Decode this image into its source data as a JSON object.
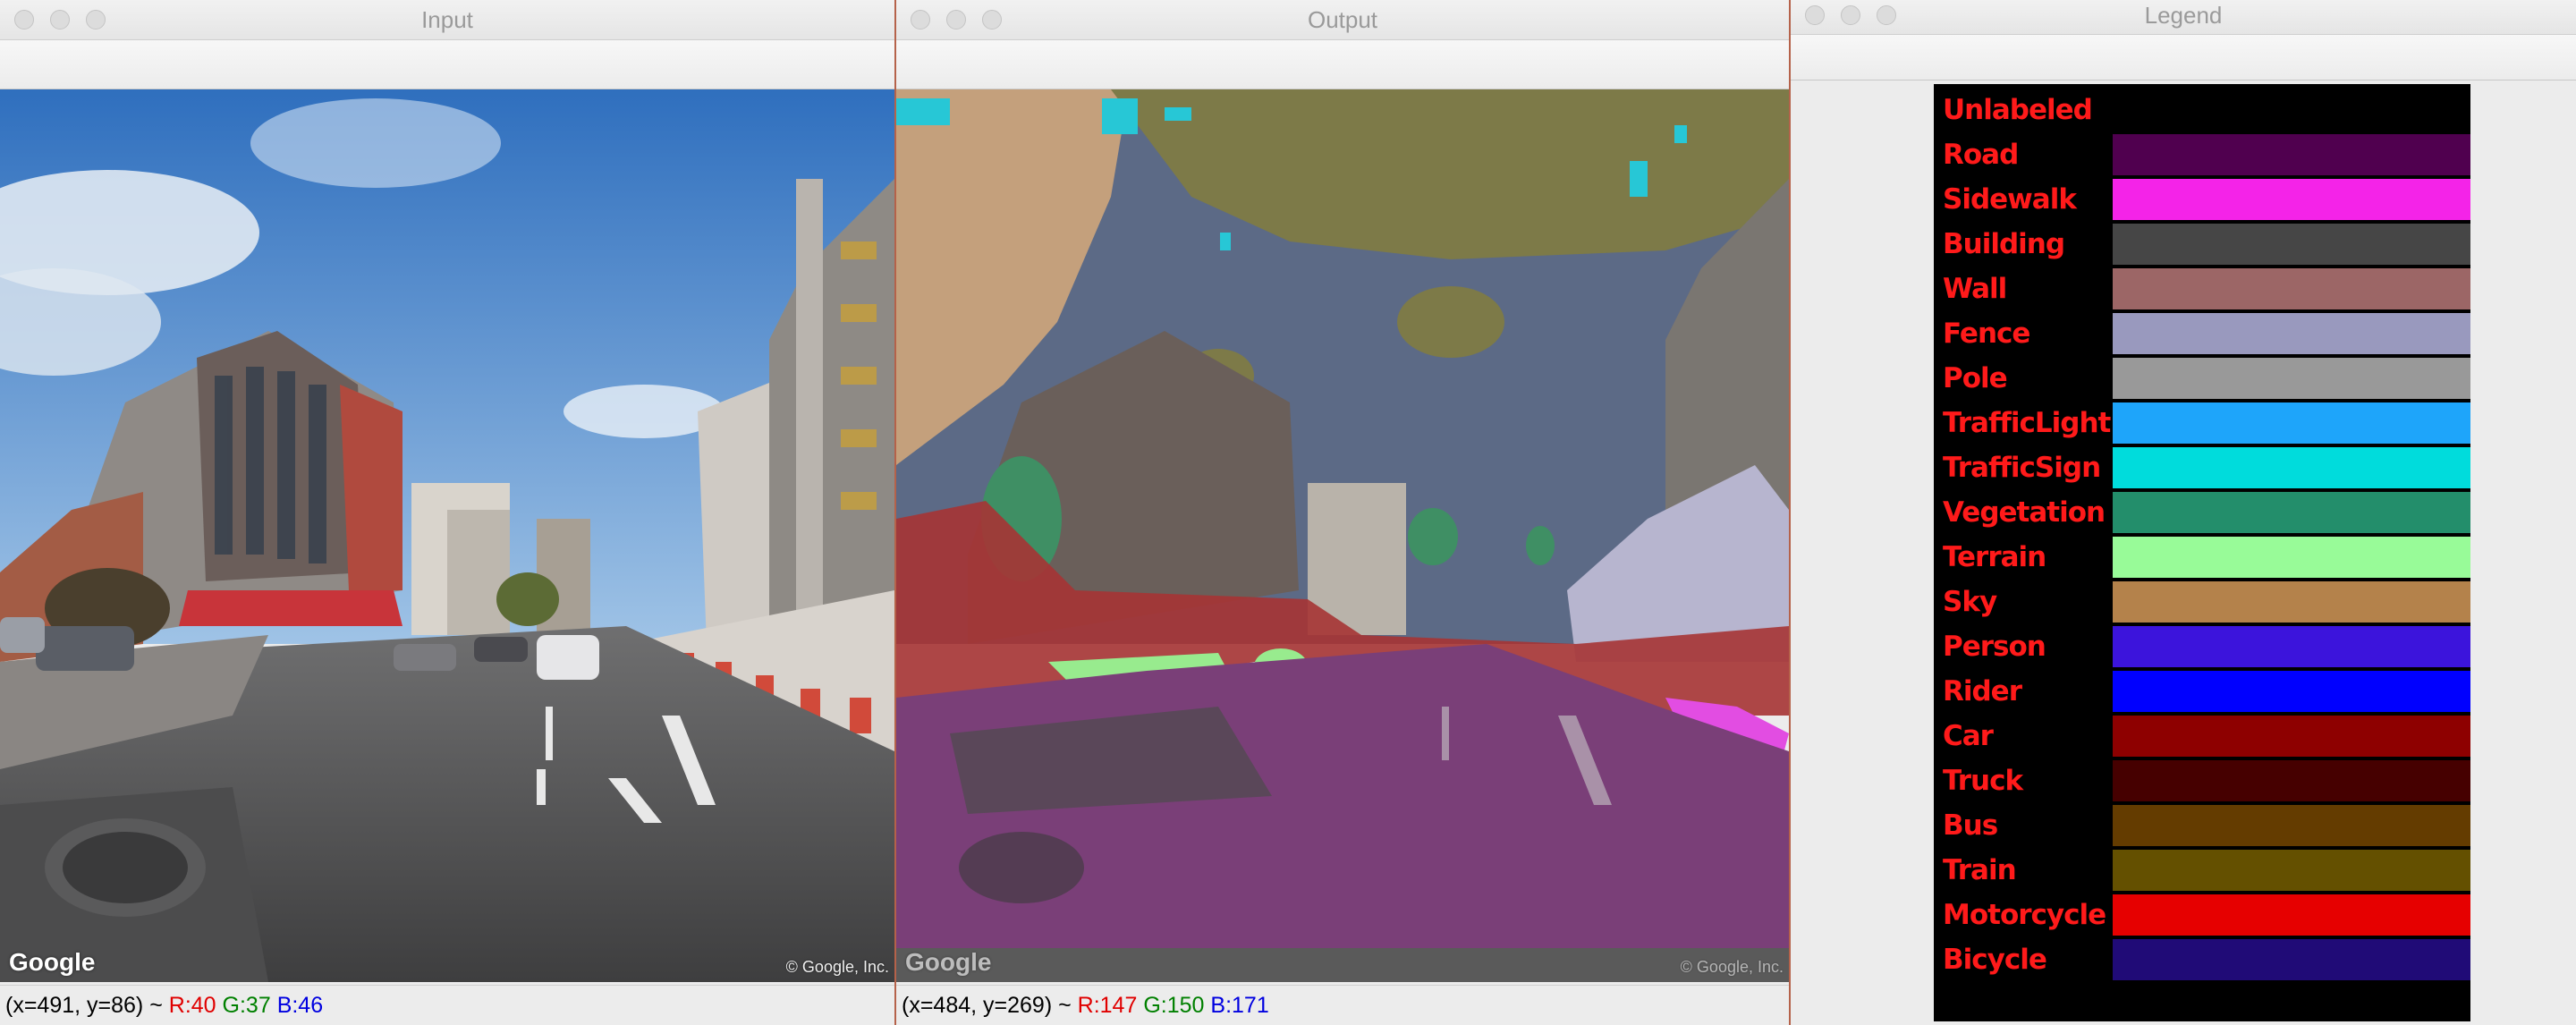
{
  "windows": {
    "input": {
      "title": "Input",
      "status": {
        "coords": "(x=491, y=86) ~ ",
        "r": "R:40",
        "g": "G:37",
        "b": "B:46"
      },
      "watermark": "Google",
      "copyright": "© Google, Inc."
    },
    "output": {
      "title": "Output",
      "status": {
        "coords": "(x=484, y=269) ~ ",
        "r": "R:147",
        "g": "G:150",
        "b": "B:171"
      },
      "watermark": "Google",
      "copyright": "© Google, Inc."
    },
    "legend": {
      "title": "Legend"
    }
  },
  "legend": {
    "items": [
      {
        "label": "Unlabeled",
        "color": "#000000"
      },
      {
        "label": "Road",
        "color": "#50004f"
      },
      {
        "label": "Sidewalk",
        "color": "#f423e8"
      },
      {
        "label": "Building",
        "color": "#464646"
      },
      {
        "label": "Wall",
        "color": "#9c6666"
      },
      {
        "label": "Fence",
        "color": "#9999be"
      },
      {
        "label": "Pole",
        "color": "#999999"
      },
      {
        "label": "TrafficLight",
        "color": "#1ea5fa"
      },
      {
        "label": "TrafficSign",
        "color": "#00dcdc"
      },
      {
        "label": "Vegetation",
        "color": "#238e6b"
      },
      {
        "label": "Terrain",
        "color": "#98fb98"
      },
      {
        "label": "Sky",
        "color": "#b4824b"
      },
      {
        "label": "Person",
        "color": "#3c14dc"
      },
      {
        "label": "Rider",
        "color": "#0000ff"
      },
      {
        "label": "Car",
        "color": "#8e0000"
      },
      {
        "label": "Truck",
        "color": "#460000"
      },
      {
        "label": "Bus",
        "color": "#643c00"
      },
      {
        "label": "Train",
        "color": "#645000"
      },
      {
        "label": "Motorcycle",
        "color": "#e60000"
      },
      {
        "label": "Bicycle",
        "color": "#200b77"
      }
    ]
  }
}
